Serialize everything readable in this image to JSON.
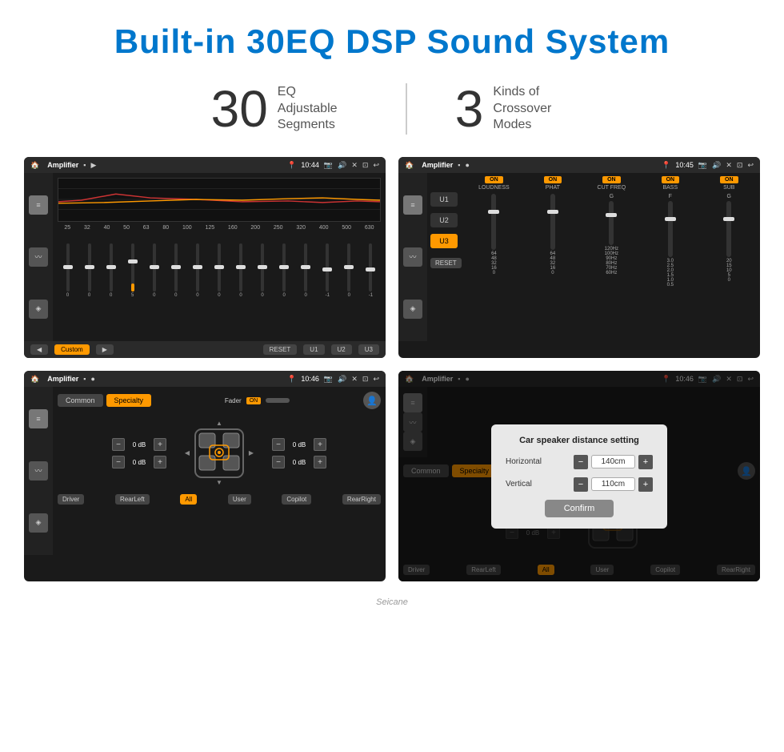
{
  "header": {
    "title": "Built-in 30EQ DSP Sound System",
    "title_color": "#0077cc"
  },
  "stats": [
    {
      "number": "30",
      "desc": "EQ Adjustable\nSegments"
    },
    {
      "number": "3",
      "desc": "Kinds of\nCrossover Modes"
    }
  ],
  "screens": {
    "eq": {
      "status": {
        "app": "Amplifier",
        "time": "10:44",
        "icons": [
          "record",
          "play",
          "location",
          "camera",
          "volume",
          "close",
          "screen",
          "back"
        ]
      },
      "freq_labels": [
        "25",
        "32",
        "40",
        "50",
        "63",
        "80",
        "100",
        "125",
        "160",
        "200",
        "250",
        "320",
        "400",
        "500",
        "630"
      ],
      "slider_values": [
        "0",
        "0",
        "0",
        "0",
        "5",
        "0",
        "0",
        "0",
        "0",
        "0",
        "0",
        "0",
        "0",
        "-1",
        "0",
        "-1"
      ],
      "bottom_buttons": [
        "◀",
        "Custom",
        "▶",
        "RESET",
        "U1",
        "U2",
        "U3"
      ]
    },
    "crossover": {
      "status": {
        "app": "Amplifier",
        "time": "10:45"
      },
      "u_buttons": [
        "U1",
        "U2",
        "U3"
      ],
      "active_u": "U3",
      "channels": [
        {
          "label": "LOUDNESS",
          "toggle": "ON"
        },
        {
          "label": "PHAT",
          "toggle": "ON"
        },
        {
          "label": "CUT FREQ",
          "toggle": "ON"
        },
        {
          "label": "BASS",
          "toggle": "ON"
        },
        {
          "label": "SUB",
          "toggle": "ON"
        }
      ],
      "reset_label": "RESET"
    },
    "specialty": {
      "status": {
        "app": "Amplifier",
        "time": "10:46"
      },
      "tabs": [
        "Common",
        "Specialty"
      ],
      "active_tab": "Specialty",
      "fader_label": "Fader",
      "fader_on": "ON",
      "db_rows": [
        {
          "value": "0 dB"
        },
        {
          "value": "0 dB"
        },
        {
          "value": "0 dB"
        },
        {
          "value": "0 dB"
        }
      ],
      "bottom_buttons": [
        "Driver",
        "RearLeft",
        "All",
        "User",
        "Copilot",
        "RearRight"
      ],
      "active_bottom": "All"
    },
    "distance": {
      "status": {
        "app": "Amplifier",
        "time": "10:46"
      },
      "tabs": [
        "Common",
        "Specialty"
      ],
      "dialog": {
        "title": "Car speaker distance setting",
        "horizontal_label": "Horizontal",
        "horizontal_value": "140cm",
        "vertical_label": "Vertical",
        "vertical_value": "110cm",
        "confirm_label": "Confirm"
      },
      "db_rows": [
        {
          "value": "0 dB"
        },
        {
          "value": "0 dB"
        }
      ],
      "bottom_buttons": [
        "Driver",
        "RearLeft",
        "All",
        "User",
        "Copilot",
        "RearRight"
      ]
    }
  },
  "watermark": "Seicane"
}
